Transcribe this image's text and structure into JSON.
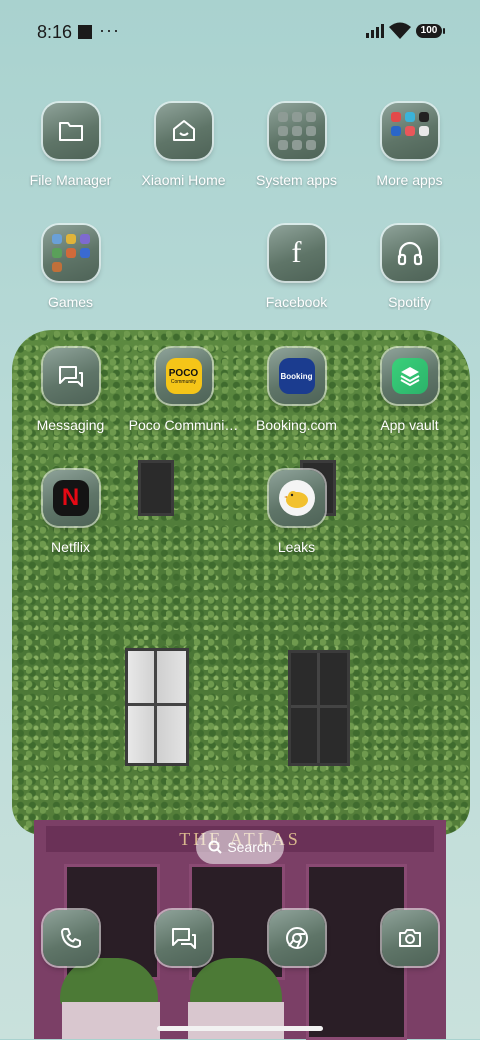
{
  "status_bar": {
    "time": "8:16",
    "overflow": "···",
    "battery": "100"
  },
  "apps": [
    {
      "label": "File Manager"
    },
    {
      "label": "Xiaomi Home"
    },
    {
      "label": "System apps"
    },
    {
      "label": "More apps"
    },
    {
      "label": "Games"
    },
    {
      "label": "Facebook"
    },
    {
      "label": "Spotify"
    },
    {
      "label": "Messaging"
    },
    {
      "label": "Poco Communi…"
    },
    {
      "label": "Booking.com"
    },
    {
      "label": "App vault"
    },
    {
      "label": "Netflix"
    },
    {
      "label": "Leaks"
    }
  ],
  "icon_text": {
    "poco_top": "POCO",
    "poco_bottom": "Community",
    "booking": "Booking",
    "netflix": "N",
    "facebook": "f"
  },
  "wallpaper": {
    "shop_sign": "THE ATLAS"
  },
  "search": {
    "label": "Search"
  },
  "dock": [
    {
      "icon": "phone-icon"
    },
    {
      "icon": "messaging-icon"
    },
    {
      "icon": "chrome-icon"
    },
    {
      "icon": "camera-icon"
    }
  ],
  "colors": {
    "sky_top": "#a9d2cf",
    "tile": "#5f7568",
    "shop": "#7b3f66"
  }
}
